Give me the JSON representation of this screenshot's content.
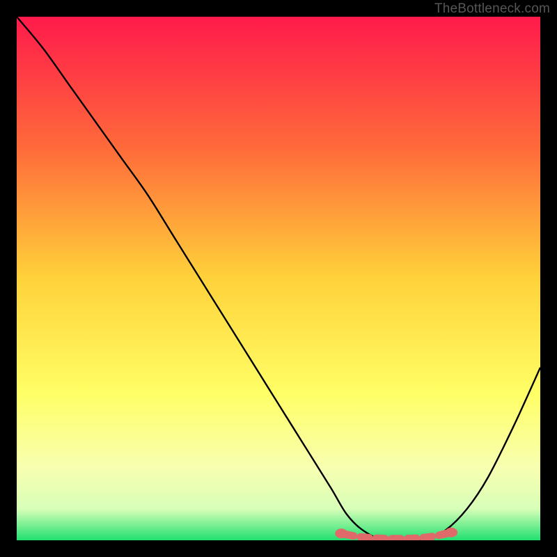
{
  "attribution": "TheBottleneck.com",
  "chart_data": {
    "type": "line",
    "title": "",
    "xlabel": "",
    "ylabel": "",
    "xlim": [
      0,
      100
    ],
    "ylim": [
      0,
      100
    ],
    "gradient_stops": [
      {
        "offset": 0,
        "color": "#ff1a4b"
      },
      {
        "offset": 25,
        "color": "#ff6a3a"
      },
      {
        "offset": 50,
        "color": "#ffd23a"
      },
      {
        "offset": 72,
        "color": "#ffff66"
      },
      {
        "offset": 86,
        "color": "#f8ffb0"
      },
      {
        "offset": 94,
        "color": "#d8ffb8"
      },
      {
        "offset": 100,
        "color": "#20e070"
      }
    ],
    "series": [
      {
        "name": "bottleneck-curve",
        "x": [
          0,
          5,
          10,
          15,
          20,
          25,
          30,
          35,
          40,
          45,
          50,
          55,
          60,
          63,
          66,
          70,
          74,
          78,
          82,
          86,
          90,
          95,
          100
        ],
        "y": [
          100,
          94,
          87,
          80,
          73,
          66,
          58,
          50,
          42,
          34,
          26,
          18,
          10,
          5,
          2,
          0,
          0,
          0,
          2,
          6,
          12,
          22,
          33
        ]
      }
    ],
    "markers": {
      "name": "optimal-range",
      "color": "#e06a6a",
      "x": [
        62,
        65,
        68,
        71,
        74,
        77,
        80,
        83
      ],
      "y": [
        1.3,
        0.7,
        0.4,
        0.3,
        0.3,
        0.4,
        0.8,
        1.5
      ]
    }
  }
}
